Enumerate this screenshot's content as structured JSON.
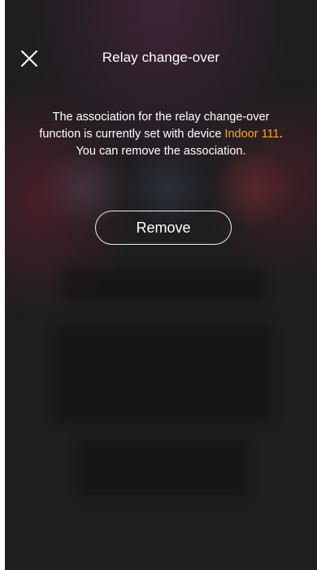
{
  "header": {
    "title": "Relay change-over",
    "close_icon": "close-icon"
  },
  "message": {
    "line1": "The association for the relay change-over",
    "line2_prefix": "function is currently set with device ",
    "device_name": "Indoor 111",
    "line2_suffix": ".",
    "line3": "You can remove the association."
  },
  "actions": {
    "remove_label": "Remove"
  },
  "colors": {
    "background": "#1e1e20",
    "text": "#ffffff",
    "highlight": "#f5a623",
    "button_border": "#e9e9ea"
  }
}
